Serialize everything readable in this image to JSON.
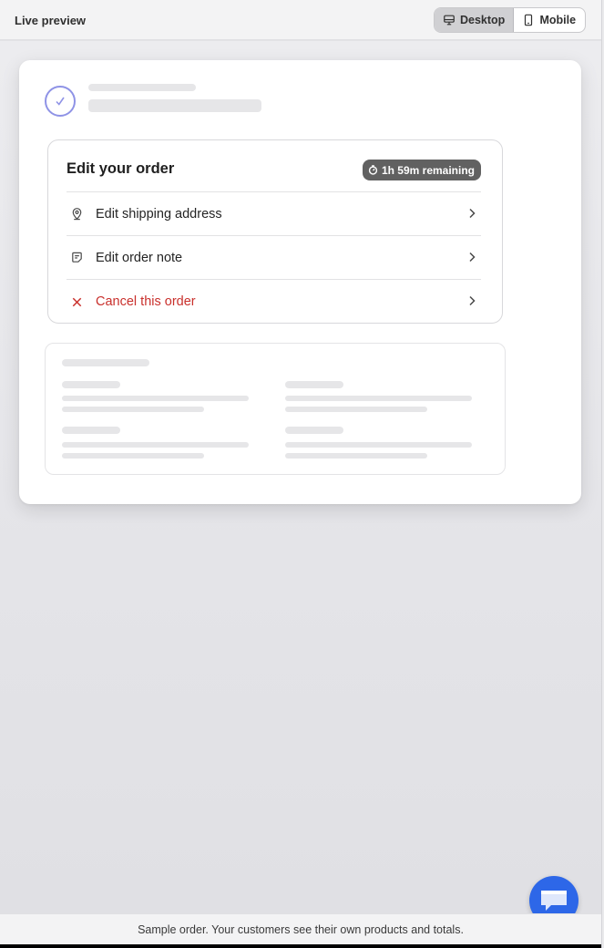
{
  "topbar": {
    "title": "Live preview",
    "view_options": [
      {
        "label": "Desktop",
        "icon": "desktop-icon",
        "selected": true
      },
      {
        "label": "Mobile",
        "icon": "mobile-icon",
        "selected": false
      }
    ]
  },
  "edit_order": {
    "title": "Edit your order",
    "timer_badge": "1h 59m remaining",
    "actions": [
      {
        "label": "Edit shipping address",
        "icon": "location-pin-icon"
      },
      {
        "label": "Edit order note",
        "icon": "note-icon"
      },
      {
        "label": "Cancel this order",
        "icon": "x-icon",
        "tone": "danger"
      }
    ]
  },
  "footer": {
    "text": "Sample order. Your customers see their own products and totals."
  },
  "colors": {
    "accent_check": "#8f93e6",
    "badge_bg": "#616161",
    "danger": "#c9302c",
    "chat_button": "#2d67e8"
  }
}
